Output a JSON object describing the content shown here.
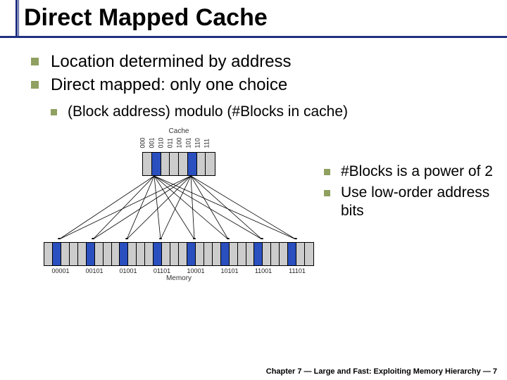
{
  "title": "Direct Mapped Cache",
  "bullets": {
    "b1_0": "Location determined by address",
    "b1_1": "Direct mapped: only one choice",
    "b2_0": "(Block address) modulo (#Blocks in cache)",
    "side_0": "#Blocks is a power of 2",
    "side_1": "Use low-order address bits"
  },
  "diagram": {
    "cache_label": "Cache",
    "memory_label": "Memory",
    "cache_bits": [
      "000",
      "001",
      "010",
      "011",
      "100",
      "101",
      "110",
      "111"
    ],
    "mem_addrs": [
      "00001",
      "00101",
      "01001",
      "01101",
      "10001",
      "10101",
      "11001",
      "11101"
    ]
  },
  "footer": "Chapter 7 — Large and Fast: Exploiting Memory Hierarchy — 7"
}
